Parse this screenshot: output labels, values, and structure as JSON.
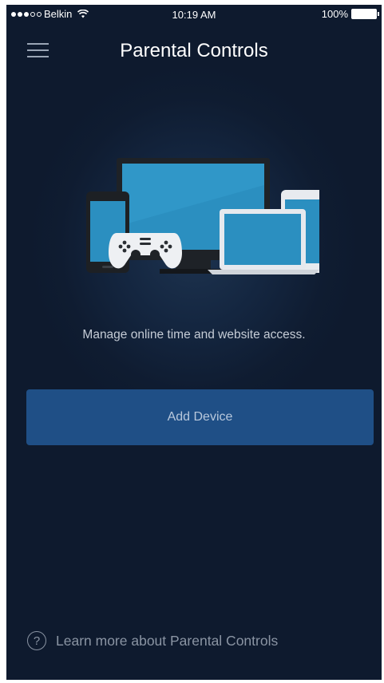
{
  "status_bar": {
    "carrier": "Belkin",
    "time": "10:19 AM",
    "battery": "100%",
    "signal_strength": "3 of 5"
  },
  "header": {
    "title": "Parental Controls",
    "menu_icon": "hamburger-menu-icon"
  },
  "main": {
    "illustration": "devices-illustration",
    "tagline": "Manage online time and website access.",
    "add_device_label": "Add Device"
  },
  "footer": {
    "help_icon_glyph": "?",
    "learn_more_label": "Learn more about Parental Controls"
  },
  "colors": {
    "background": "#0f1c31",
    "button": "#1f4f86",
    "title_text": "#ffffff"
  }
}
